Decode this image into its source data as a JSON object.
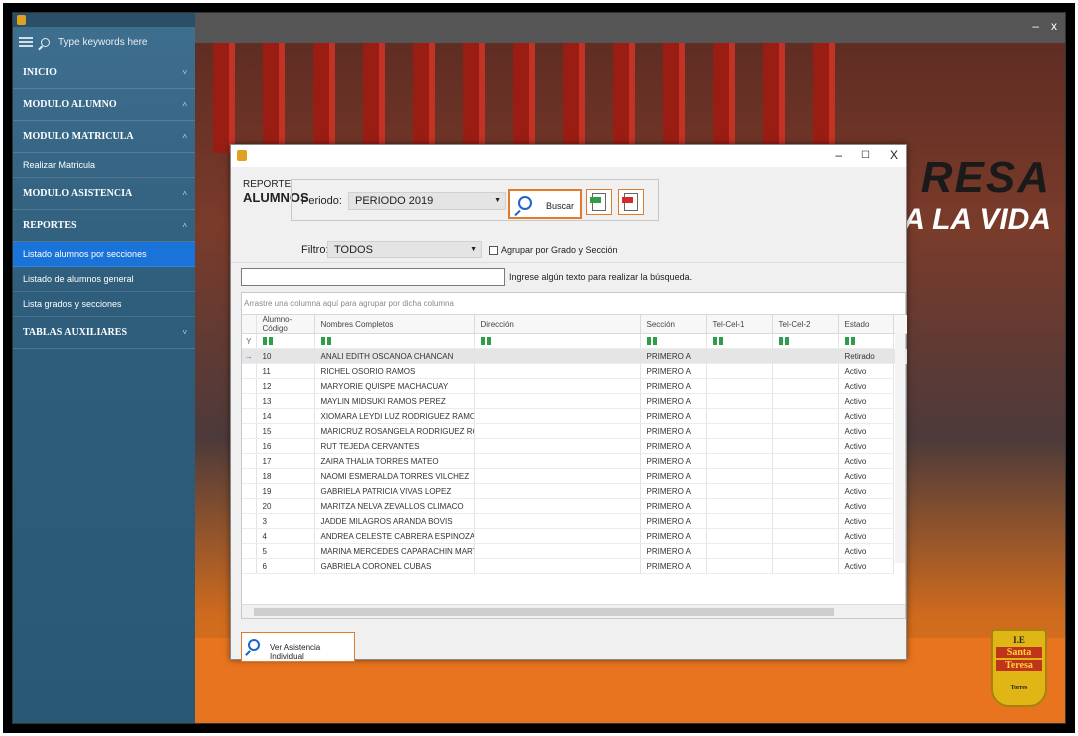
{
  "sidebar": {
    "search_placeholder": "Type keywords here",
    "items": [
      {
        "label": "INICIO",
        "chevron": "˅"
      },
      {
        "label": "MODULO ALUMNO",
        "chevron": "˄"
      },
      {
        "label": "MODULO MATRICULA",
        "chevron": "˄"
      },
      {
        "label": "Realizar Matricula"
      },
      {
        "label": "MODULO ASISTENCIA",
        "chevron": "˄"
      },
      {
        "label": "REPORTES",
        "chevron": "˄"
      },
      {
        "label": "Listado alumnos  por secciones"
      },
      {
        "label": "Listado de alumnos general"
      },
      {
        "label": "Lista grados y secciones"
      },
      {
        "label": "TABLAS AUXILIARES",
        "chevron": "˅"
      }
    ]
  },
  "window": {
    "minimize": "–",
    "close": "x"
  },
  "background": {
    "banner": "RESA",
    "banner_sub": "A LA VIDA",
    "seal_top": "I.E",
    "seal_mid1": "Santa",
    "seal_mid2": "Teresa",
    "seal_bottom": "Torres"
  },
  "dialog": {
    "controls": {
      "minimize": "–",
      "maximize": "☐",
      "close": "X"
    },
    "report_title_1": "REPORTE",
    "report_title_2": "ALUMNOS",
    "periodo_label": "Periodo:",
    "periodo_value": "PERIODO 2019",
    "buscar_label": "Buscar",
    "filtro_label": "Filtro:",
    "filtro_value": "TODOS",
    "agrupar_label": "Agrupar por Grado y Sección",
    "search_hint": "Ingrese algún texto para realizar la búsqueda.",
    "group_hint": "Arrastre una columna aquí para agrupar por dicha columna",
    "ver_asistencia": "Ver Asistencia Individual",
    "columns": [
      "Alumno-Código",
      "Nombres Completos",
      "Dirección",
      "Sección",
      "Tel-Cel-1",
      "Tel-Cel-2",
      "Estado"
    ],
    "rows": [
      [
        "10",
        "ANALI EDITH OSCANOA CHANCAN",
        "",
        "PRIMERO A",
        "",
        "",
        "Retirado"
      ],
      [
        "11",
        "RICHEL  OSORIO RAMOS",
        "",
        "PRIMERO A",
        "",
        "",
        "Activo"
      ],
      [
        "12",
        "MARYORIE  QUISPE MACHACUAY",
        "",
        "PRIMERO A",
        "",
        "",
        "Activo"
      ],
      [
        "13",
        "MAYLIN MIDSUKI RAMOS PEREZ",
        "",
        "PRIMERO A",
        "",
        "",
        "Activo"
      ],
      [
        "14",
        "XIOMARA LEYDI LUZ RODRIGUEZ RAMOS",
        "",
        "PRIMERO A",
        "",
        "",
        "Activo"
      ],
      [
        "15",
        "MARICRUZ ROSANGELA RODRIGUEZ ROSARIO",
        "",
        "PRIMERO A",
        "",
        "",
        "Activo"
      ],
      [
        "16",
        "RUT  TEJEDA CERVANTES",
        "",
        "PRIMERO A",
        "",
        "",
        "Activo"
      ],
      [
        "17",
        "ZAIRA THALIA TORRES MATEO",
        "",
        "PRIMERO A",
        "",
        "",
        "Activo"
      ],
      [
        "18",
        "NAOMI ESMERALDA TORRES VILCHEZ",
        "",
        "PRIMERO A",
        "",
        "",
        "Activo"
      ],
      [
        "19",
        "GABRIELA PATRICIA VIVAS LOPEZ",
        "",
        "PRIMERO A",
        "",
        "",
        "Activo"
      ],
      [
        "20",
        "MARITZA NELVA ZEVALLOS CLIMACO",
        "",
        "PRIMERO A",
        "",
        "",
        "Activo"
      ],
      [
        "3",
        "JADDE MILAGROS ARANDA BOVIS",
        "",
        "PRIMERO A",
        "",
        "",
        "Activo"
      ],
      [
        "4",
        "ANDREA CELESTE CABRERA ESPINOZA",
        "",
        "PRIMERO A",
        "",
        "",
        "Activo"
      ],
      [
        "5",
        "MARINA MERCEDES CAPARACHIN MARTINEZ",
        "",
        "PRIMERO A",
        "",
        "",
        "Activo"
      ],
      [
        "6",
        "GABRIELA  CORONEL CUBAS",
        "",
        "PRIMERO A",
        "",
        "",
        "Activo"
      ]
    ],
    "selected_row_indicator": "→",
    "filter_icon": "Y"
  }
}
